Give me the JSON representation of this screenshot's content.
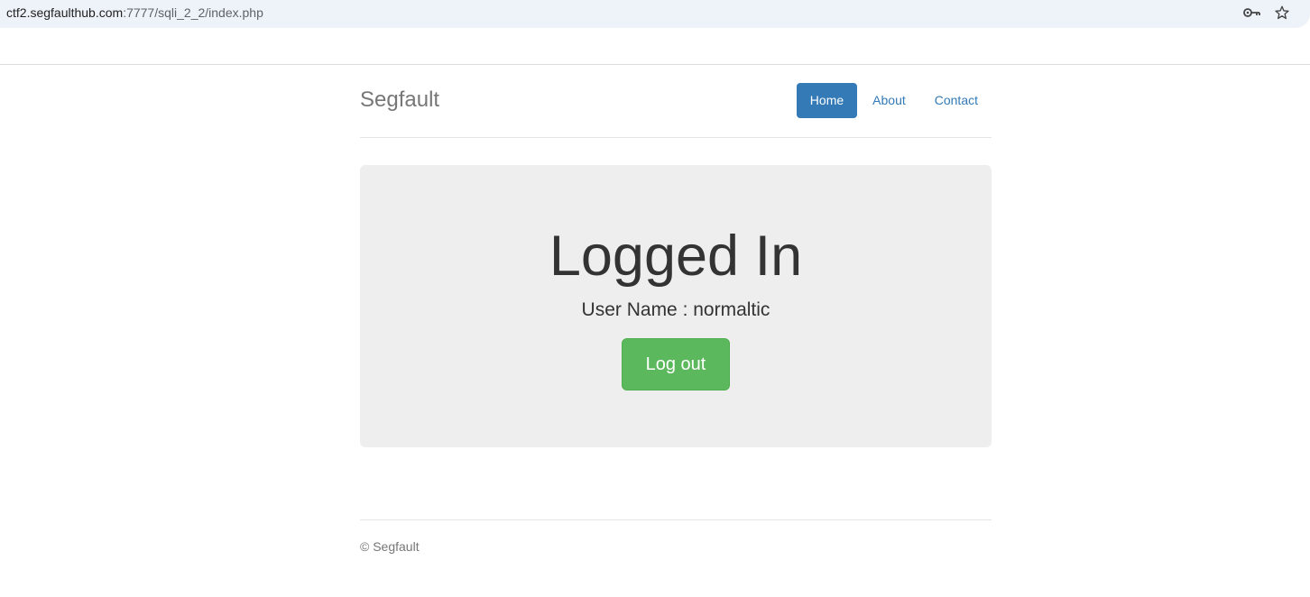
{
  "browser": {
    "url_host": "ctf2.segfaulthub.com",
    "url_path": ":7777/sqli_2_2/index.php",
    "icons": [
      "key-icon",
      "star-icon"
    ]
  },
  "header": {
    "brand": "Segfault",
    "nav": [
      {
        "label": "Home",
        "active": true
      },
      {
        "label": "About",
        "active": false
      },
      {
        "label": "Contact",
        "active": false
      }
    ]
  },
  "jumbotron": {
    "title": "Logged In",
    "user_line": "User Name : normaltic",
    "logout_label": "Log out"
  },
  "footer": {
    "text": "© Segfault"
  },
  "colors": {
    "primary": "#337ab7",
    "success": "#5cb85c",
    "jumbotron_bg": "#eeeeee",
    "urlbar_bg": "#eef2f9"
  }
}
